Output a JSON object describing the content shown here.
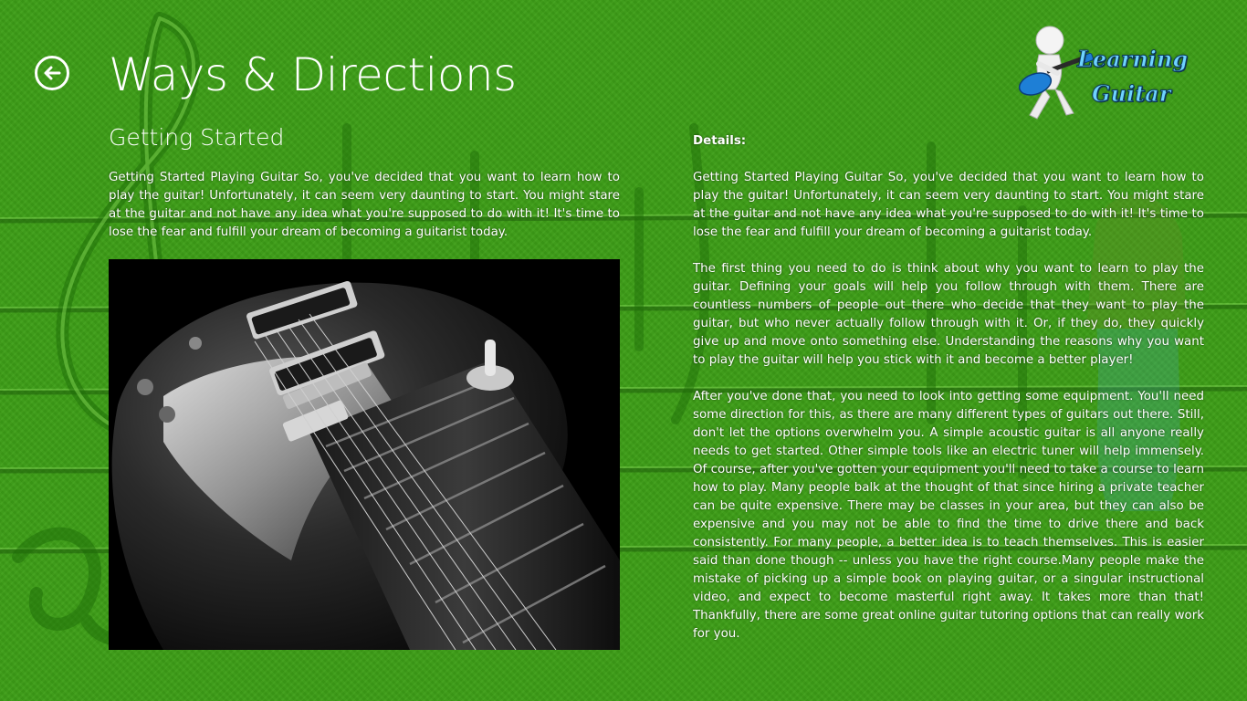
{
  "header": {
    "title": "Ways & Directions",
    "back_icon": "back-arrow-icon",
    "logo": {
      "icon": "guitar-player-figure-icon",
      "line1": "Learning",
      "line2": "Guitar"
    }
  },
  "left": {
    "section_title": "Getting Started",
    "intro": "Getting Started Playing Guitar So, you've decided that you want to learn how to play the guitar! Unfortunately, it can seem very daunting to start. You might stare at the guitar and not have any idea what you're supposed to do with it! It's time to lose the fear and fulfill your dream of becoming a guitarist today."
  },
  "right": {
    "details_label": "Details:",
    "paragraphs": [
      "Getting Started Playing Guitar So, you've decided that you want to learn how to play the guitar! Unfortunately, it can seem very daunting to start. You might stare at the guitar and not have any idea what you're supposed to do with it! It's time to lose the fear and fulfill your dream of becoming a guitarist today.",
      "The first thing you need to do is think about why you want to learn to play the guitar. Defining your goals will help you follow through with them. There are countless numbers of people out there who decide that they want to play the guitar, but who never actually follow through with it. Or, if they do, they quickly give up and move onto something else. Understanding the reasons why you want to play the guitar will help you stick with it and become a better player!",
      "After you've done that, you need to look into getting some equipment. You'll need some direction for this, as there are many different types of guitars out there. Still, don't let the options overwhelm you. A simple acoustic guitar is all anyone really needs to get started. Other simple tools like an electric tuner will help immensely. Of course, after you've gotten your equipment you'll need to take a course to learn how to play. Many people balk at the thought of that since hiring a private teacher can be quite expensive. There may be classes in your area, but they can also be expensive and you may not be able to find the time to drive there and back consistently. For many people, a better idea is to teach themselves. This is easier said than done though -- unless you have the right course.Many people make the mistake of picking up a simple book on playing guitar, or a singular instructional video, and expect to become masterful right away. It takes more than that! Thankfully, there are some great online guitar tutoring options that can really work for you."
    ]
  },
  "colors": {
    "background": "#3d9e17",
    "text": "#ffffff",
    "logo_text": "#6fd3ff"
  }
}
